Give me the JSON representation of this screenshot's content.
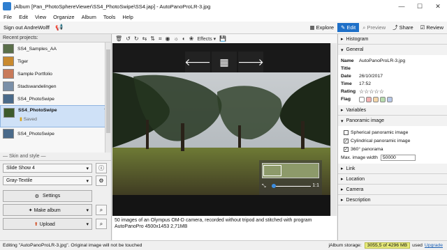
{
  "window": {
    "title": "jAlbum [Pan_PhotoSphereViewer\\SS4_PhotoSwipe\\SS4.jap] - AutoPanoProLR-3.jpg",
    "minimize": "—",
    "maximize": "☐",
    "close": "✕"
  },
  "menu": [
    "File",
    "Edit",
    "View",
    "Organize",
    "Album",
    "Tools",
    "Help"
  ],
  "toolbar": {
    "sign_out": "Sign out AndreWolff",
    "explore": "Explore",
    "edit": "Edit",
    "preview": "Preview",
    "share": "Share",
    "review": "Review"
  },
  "left": {
    "recent_header": "Recent projects:",
    "projects": [
      {
        "name": "SS4_Samples_AA"
      },
      {
        "name": "Tiger"
      },
      {
        "name": "Sample Portfolio"
      },
      {
        "name": "Stadswandelingen"
      },
      {
        "name": "SS4_PhotoSwipe"
      },
      {
        "name": "SS4_PhotoSwipe",
        "status": "Saved"
      },
      {
        "name": "SS4_PhotoSwipe"
      }
    ],
    "skin_header": "Skin and style",
    "skin": "Slide Show 4",
    "style": "Gray-Textile",
    "settings": "Settings",
    "make_album": "Make album",
    "upload": "Upload"
  },
  "center": {
    "effects": "Effects",
    "zoom_label": "1:1",
    "caption_line1": "50 images of an Olympus OM-D camera, recorded without tripod and stitched with program",
    "caption_line2": "AutoPanoPro 4500x1453 2,71MB"
  },
  "right": {
    "histogram": "Histogram",
    "general": "General",
    "fields": [
      {
        "label": "Name",
        "value": "AutoPanoProLR-3.jpg"
      },
      {
        "label": "Title",
        "value": ""
      },
      {
        "label": "Date",
        "value": "26/10/2017"
      },
      {
        "label": "Time",
        "value": "17:52"
      },
      {
        "label": "Rating",
        "value": "☆☆☆☆☆"
      },
      {
        "label": "Flag",
        "value": ""
      }
    ],
    "flag_colors": [
      "#ffffff",
      "#f3b0b0",
      "#f3d5a8",
      "#b7dcae",
      "#b8c8e8"
    ],
    "variables": "Variables",
    "panorama": "Panoramic image",
    "spherical": "Spherical panoramic image",
    "cylindrical": "Cylindrical panoramic image",
    "deg360": "360° panorama",
    "max_width_label": "Max. image width",
    "max_width_value": "50000",
    "link": "Link",
    "location": "Location",
    "camera": "Camera",
    "description": "Description"
  },
  "status": {
    "left": "Editing \"AutoPanoProLR-3.jpg\". Original image will not be touched",
    "storage_label": "jAlbum storage:",
    "storage_value": "3055,5 of 4296 MB",
    "used": "used",
    "upgrade": "Upgrade"
  }
}
